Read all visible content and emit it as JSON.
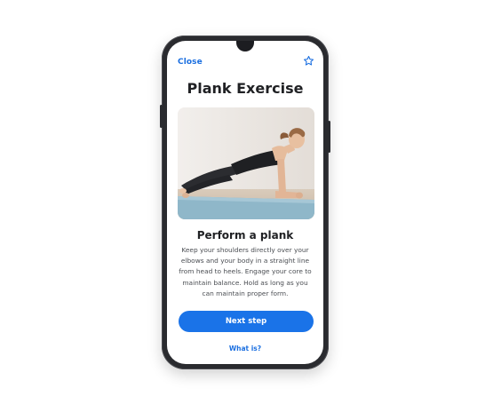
{
  "header": {
    "close_label": "Close",
    "favorite_icon": "star-outline-icon"
  },
  "exercise": {
    "title": "Plank Exercise",
    "image_icon": "woman-plank-photo",
    "step_title": "Perform a plank",
    "step_description": "Keep your shoulders directly over your elbows and your body in a straight line from head to heels. Engage your core to maintain balance. Hold as long as you can maintain proper form."
  },
  "actions": {
    "next_label": "Next step",
    "what_is_label": "What is?"
  },
  "colors": {
    "accent": "#1a73e8",
    "phone_frame": "#2a2b2f",
    "title_text": "#202124",
    "body_text": "#4a4d52"
  }
}
